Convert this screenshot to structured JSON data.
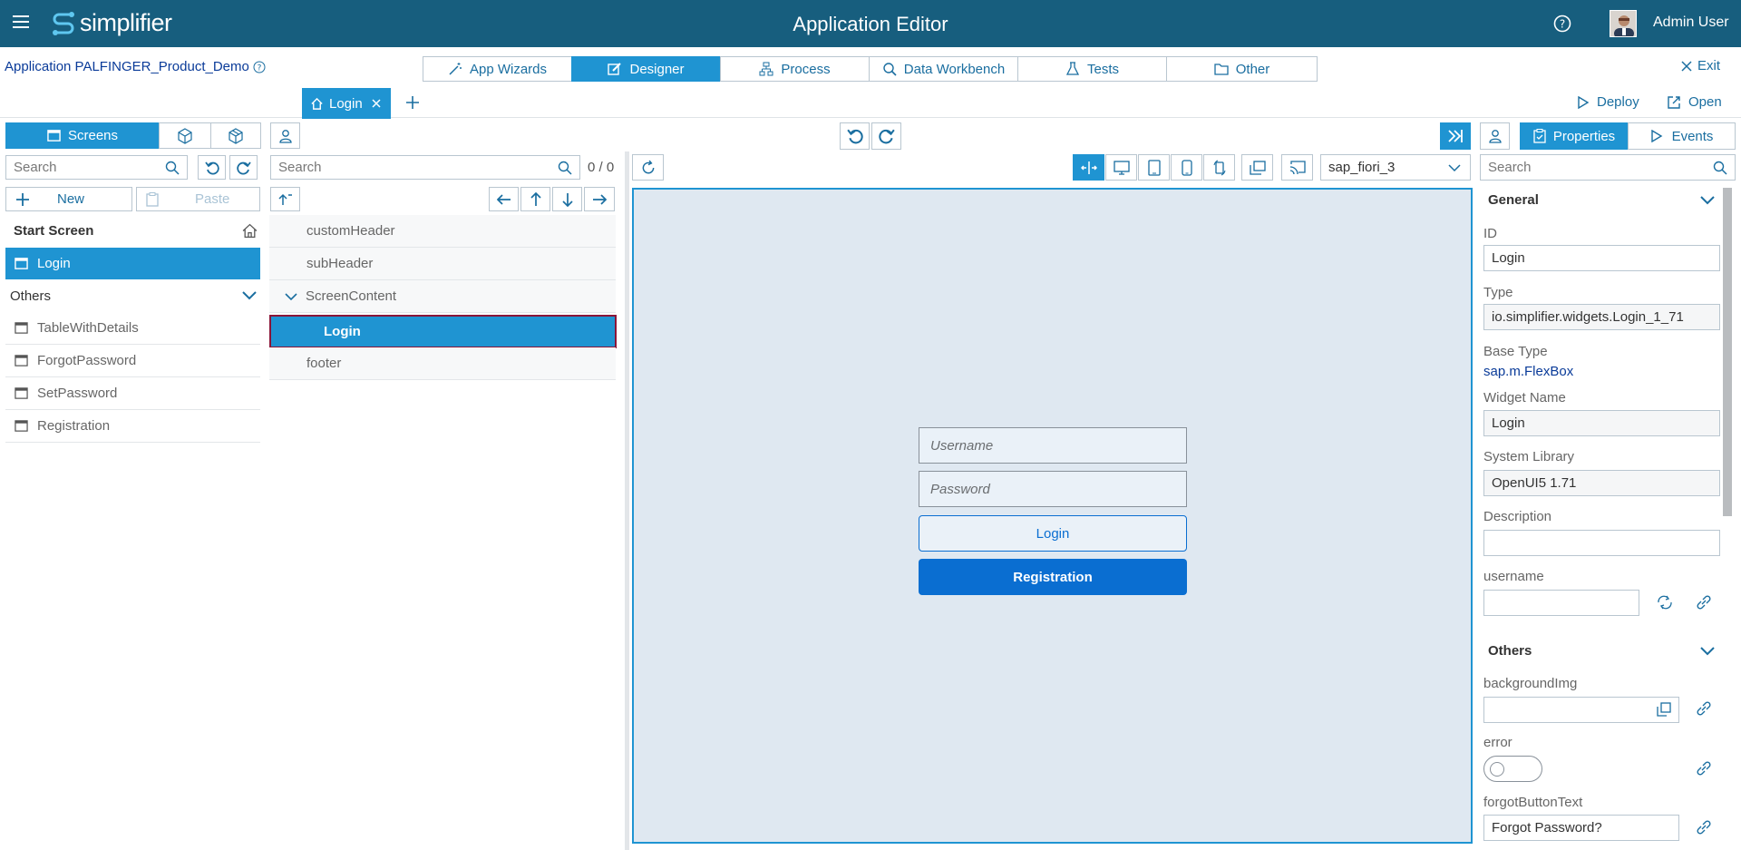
{
  "header": {
    "title": "Application Editor",
    "logo_text": "simplifier",
    "user_name": "Admin User",
    "icons": [
      "menu-icon",
      "help-icon",
      "avatar"
    ]
  },
  "appbar": {
    "app_label": "Application PALFINGER_Product_Demo",
    "exit_label": "Exit",
    "tabs": [
      {
        "label": "App Wizards",
        "icon": "wand-icon"
      },
      {
        "label": "Designer",
        "icon": "edit-icon"
      },
      {
        "label": "Process",
        "icon": "process-icon"
      },
      {
        "label": "Data Workbench",
        "icon": "data-icon"
      },
      {
        "label": "Tests",
        "icon": "flask-icon"
      },
      {
        "label": "Other",
        "icon": "folder-icon"
      }
    ]
  },
  "doc_tabs": {
    "open_tab": "Login",
    "deploy_label": "Deploy",
    "open_label": "Open"
  },
  "left": {
    "screens_label": "Screens",
    "search_placeholder": "Search",
    "new_label": "New",
    "paste_label": "Paste",
    "start_section": "Start Screen",
    "start_screen": "Login",
    "others_section": "Others",
    "others": [
      "TableWithDetails",
      "ForgotPassword",
      "SetPassword",
      "Registration"
    ]
  },
  "tree": {
    "search_placeholder": "Search",
    "count": "0 / 0",
    "items": [
      "customHeader",
      "subHeader",
      "ScreenContent",
      "Login",
      "footer"
    ]
  },
  "canvas": {
    "theme": "sap_fiori_3",
    "username_placeholder": "Username",
    "password_placeholder": "Password",
    "login_button": "Login",
    "registration_button": "Registration"
  },
  "props": {
    "properties_tab": "Properties",
    "events_tab": "Events",
    "search_placeholder": "Search",
    "general_section": "General",
    "id_label": "ID",
    "id_value": "Login",
    "type_label": "Type",
    "type_value": "io.simplifier.widgets.Login_1_71",
    "base_type_label": "Base Type",
    "base_type_value": "sap.m.FlexBox",
    "widget_name_label": "Widget Name",
    "widget_name_value": "Login",
    "system_library_label": "System Library",
    "system_library_value": "OpenUI5 1.71",
    "description_label": "Description",
    "description_value": "",
    "username_label": "username",
    "username_value": "",
    "others_section": "Others",
    "backgroundimg_label": "backgroundImg",
    "error_label": "error",
    "error_value": false,
    "forgot_label": "forgotButtonText",
    "forgot_value": "Forgot Password?"
  },
  "colors": {
    "header_bg": "#175e7e",
    "accent": "#1f94d2",
    "canvas_bg": "#dfe8f1",
    "registration_bg": "#0a6ed1"
  }
}
